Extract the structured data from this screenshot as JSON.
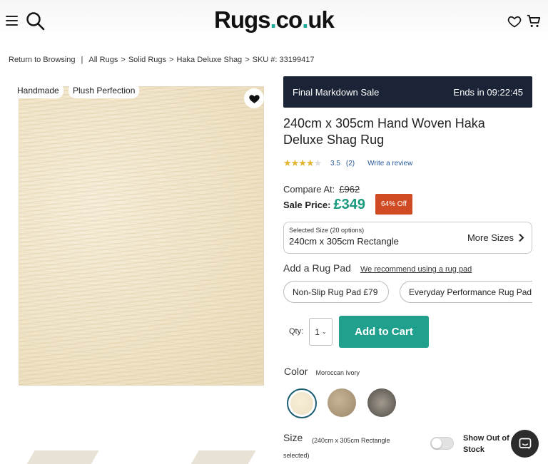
{
  "header": {
    "logo_main": "Rugs",
    "logo_dot": ".",
    "logo_mid": "co",
    "logo_dot2": ".",
    "logo_end": "uk",
    "icons": [
      "hamburger-menu-icon",
      "search-icon",
      "heart-icon",
      "cart-icon"
    ],
    "accent_color": "#1ba99a"
  },
  "breadcrumb": {
    "return": "Return to Browsing",
    "divider": "|",
    "items": [
      "All Rugs",
      "Solid Rugs",
      "Haka Deluxe Shag"
    ],
    "gt": ">",
    "sku": "SKU #: 33199417"
  },
  "image": {
    "tags": [
      "Handmade",
      "Plush Perfection"
    ],
    "fav_icon": "heart-filled-icon"
  },
  "product": {
    "banner_left": "Final Markdown Sale",
    "banner_right": "Ends in 09:22:45",
    "title": "240cm x 305cm Hand Woven Haka Deluxe Shag Rug",
    "rating_value": "3.5",
    "rating_count": "(2)",
    "rating_fraction": 0.7,
    "write_review": "Write a review",
    "compare_label": "Compare At:",
    "compare_price": "£962",
    "sale_label": "Sale Price:",
    "sale_price": "£349",
    "off_badge": "64% Off",
    "sale_color": "#1a9b7e",
    "badge_color": "#d04a24"
  },
  "size_selector": {
    "small": "Selected Size (20 options)",
    "selected": "240cm x 305cm Rectangle",
    "more": "More Sizes"
  },
  "rug_pad": {
    "title": "Add a Rug Pad",
    "link": "We recommend using a rug pad",
    "options": [
      "Non-Slip Rug Pad £79",
      "Everyday Performance Rug Pad"
    ]
  },
  "cart": {
    "qty_label": "Qty:",
    "qty_value": "1",
    "button": "Add to Cart",
    "button_color": "#20a08d"
  },
  "color": {
    "title": "Color",
    "value": "Moroccan Ivory",
    "swatches": [
      "moroccan-ivory",
      "beige-brown",
      "grey-black"
    ]
  },
  "size": {
    "title": "Size",
    "note": "(240cm x 305cm Rectangle selected)",
    "toggle_label": "Show Out of Stock",
    "toggle_on": false
  },
  "chat": {
    "icon": "chat-bubble-icon"
  }
}
